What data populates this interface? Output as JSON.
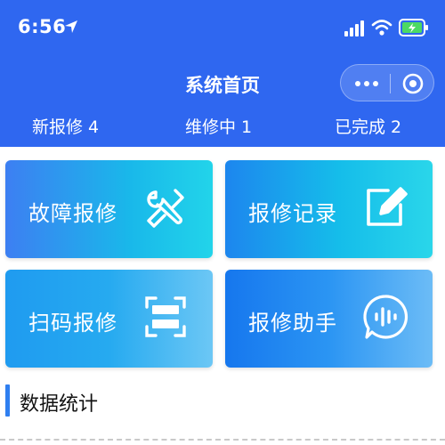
{
  "status_bar": {
    "time": "6:56",
    "icons": [
      "location-arrow-icon",
      "signal-icon",
      "wifi-icon",
      "battery-charging-icon"
    ]
  },
  "header": {
    "title": "系统首页",
    "background": "#2f67f0",
    "capsule_icons": [
      "more-dots-icon",
      "target-circle-icon"
    ]
  },
  "stats": {
    "new_repair": "新报修 4",
    "in_repair": "维修中 1",
    "completed": "已完成 2"
  },
  "cards": [
    {
      "label": "故障报修",
      "icon": "tools-icon"
    },
    {
      "label": "报修记录",
      "icon": "edit-note-icon"
    },
    {
      "label": "扫码报修",
      "icon": "scan-icon"
    },
    {
      "label": "报修助手",
      "icon": "voice-assistant-icon"
    }
  ],
  "section": {
    "title": "数据统计",
    "accent": "#2f7ff0"
  }
}
